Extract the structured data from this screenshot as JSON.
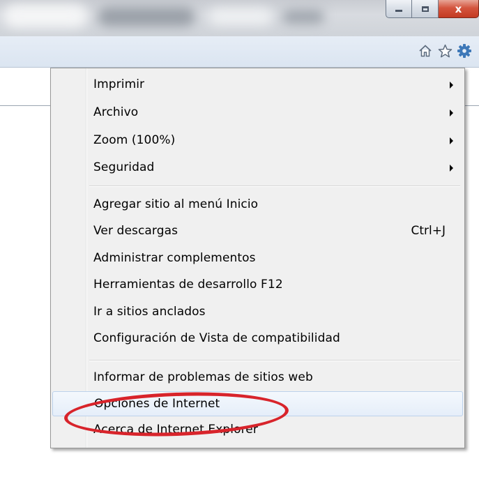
{
  "window": {
    "caption_buttons": {
      "minimize_icon": "minimize-icon",
      "maximize_icon": "maximize-icon",
      "close_label": "x"
    }
  },
  "command_bar": {
    "icons": [
      "home-icon",
      "favorites-star-icon",
      "tools-gear-icon"
    ]
  },
  "menu": {
    "groups": [
      {
        "items": [
          {
            "label": "Imprimir",
            "submenu": true
          },
          {
            "label": "Archivo",
            "submenu": true
          },
          {
            "label": "Zoom (100%)",
            "submenu": true
          },
          {
            "label": "Seguridad",
            "submenu": true
          }
        ]
      },
      {
        "items": [
          {
            "label": "Agregar sitio al menú Inicio"
          },
          {
            "label": "Ver descargas",
            "shortcut": "Ctrl+J"
          },
          {
            "label": "Administrar complementos"
          },
          {
            "label": "Herramientas de desarrollo F12"
          },
          {
            "label": "Ir a sitios anclados"
          },
          {
            "label": "Configuración de Vista de compatibilidad"
          }
        ]
      },
      {
        "items": [
          {
            "label": "Informar de problemas de sitios web"
          },
          {
            "label": "Opciones de Internet",
            "highlighted": true
          },
          {
            "label": "Acerca de Internet Explorer"
          }
        ]
      }
    ]
  },
  "colors": {
    "annotation_circle": "#d8242b",
    "menu_background": "#f0f0f0",
    "hover_background": "#e5eef9",
    "close_button": "#c33a22"
  }
}
